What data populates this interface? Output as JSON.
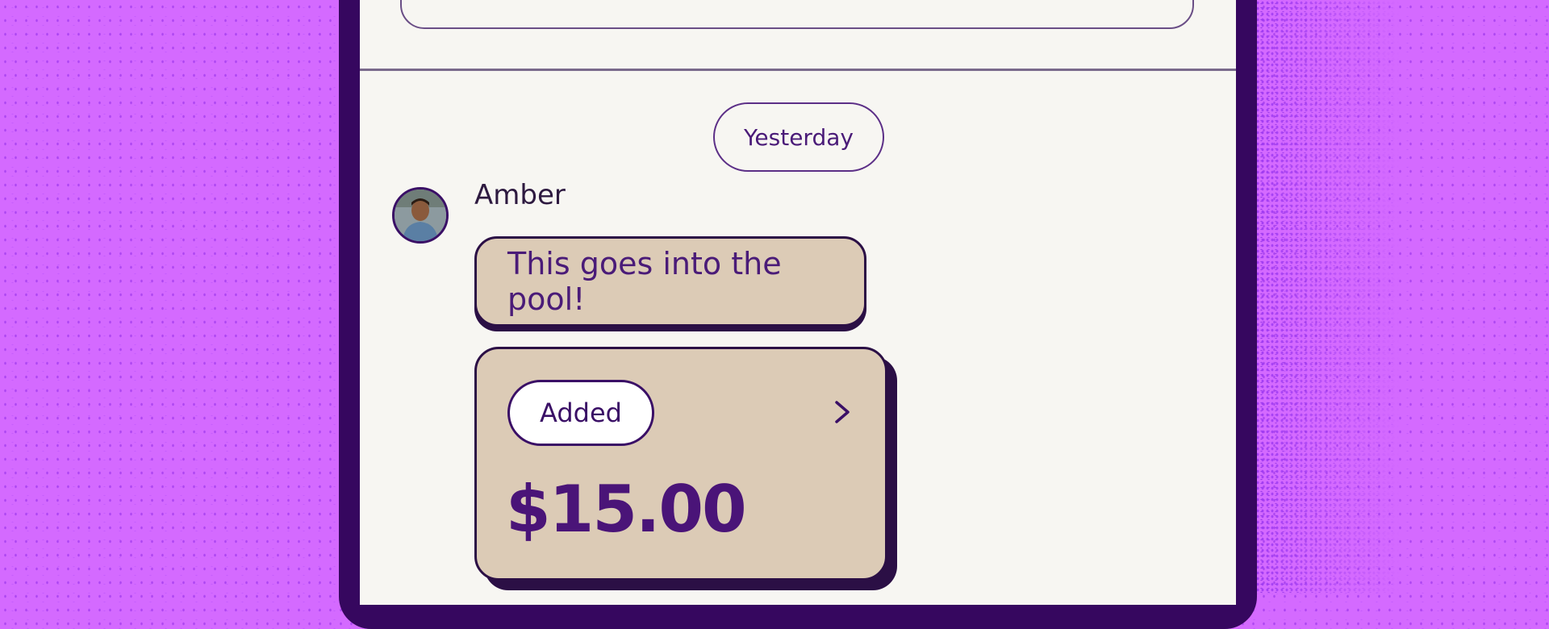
{
  "header": {
    "status_color": "#1aa864"
  },
  "chat": {
    "date_separator": "Yesterday",
    "messages": [
      {
        "sender": "Amber",
        "text": "This goes into the pool!"
      }
    ],
    "payment": {
      "status": "Added",
      "amount": "$15.00",
      "chevron_icon": "chevron-right-icon"
    }
  },
  "colors": {
    "background": "#d46aff",
    "phone_frame": "#36075f",
    "screen": "#f7f6f2",
    "bubble": "#dccbb6",
    "accent_text": "#4a1b78"
  }
}
